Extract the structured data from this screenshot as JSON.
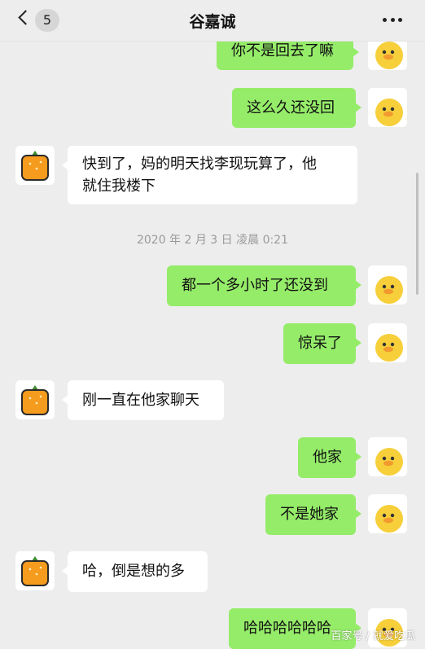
{
  "header": {
    "back_count": "5",
    "title": "谷嘉诚"
  },
  "messages": [
    {
      "text": "你不是回去了嘛"
    },
    {
      "text": "这么久还没回"
    },
    {
      "text": "快到了，妈的明天找李现玩算了，他",
      "text2": "就住我楼下"
    },
    {
      "text": "都一个多小时了还没到"
    },
    {
      "text": "惊呆了"
    },
    {
      "text": "刚一直在他家聊天"
    },
    {
      "text": "他家"
    },
    {
      "text": "不是她家"
    },
    {
      "text": "哈，倒是想的多"
    },
    {
      "text": "哈哈哈哈哈哈"
    }
  ],
  "timestamp": "2020 年 2 月 3 日  凌晨 0:21",
  "watermark": "百家号 / 就爱吃瓜",
  "colors": {
    "outgoing": "#95ec69",
    "incoming": "#ffffff",
    "background": "#ededed"
  }
}
